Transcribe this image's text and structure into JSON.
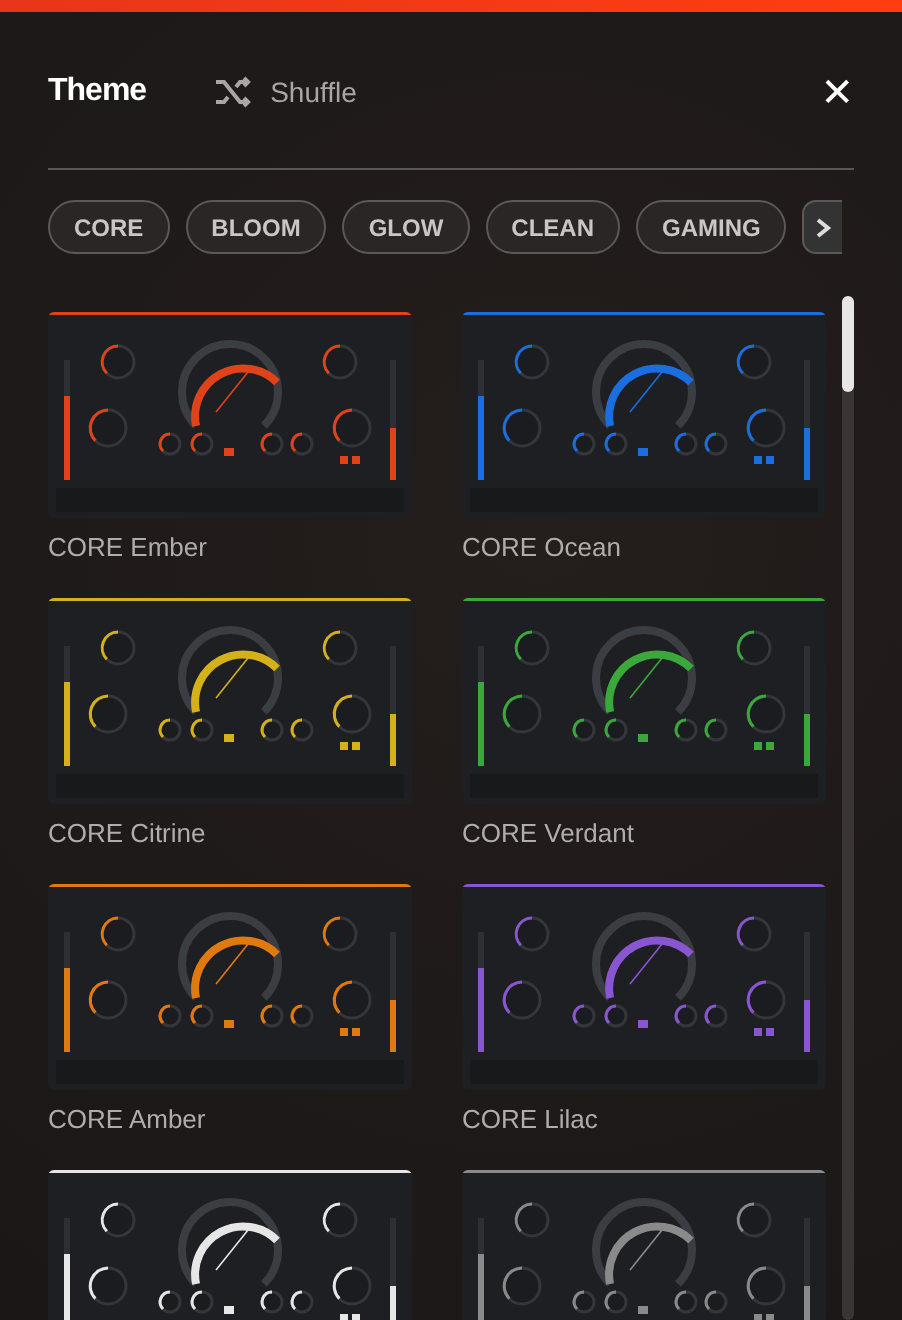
{
  "header": {
    "title": "Theme",
    "shuffle_label": "Shuffle",
    "close_label": "✕"
  },
  "categories": [
    {
      "label": "CORE"
    },
    {
      "label": "BLOOM"
    },
    {
      "label": "GLOW"
    },
    {
      "label": "CLEAN"
    },
    {
      "label": "GAMING"
    }
  ],
  "themes": [
    {
      "name": "CORE Ember",
      "color": "#e0421a"
    },
    {
      "name": "CORE Ocean",
      "color": "#1a6ee0"
    },
    {
      "name": "CORE Citrine",
      "color": "#d4b01a"
    },
    {
      "name": "CORE Verdant",
      "color": "#3aa83a"
    },
    {
      "name": "CORE Amber",
      "color": "#e07a10"
    },
    {
      "name": "CORE Lilac",
      "color": "#8a55d0"
    },
    {
      "color": "#e6e6e6"
    },
    {
      "color": "#8a8a8a"
    }
  ]
}
